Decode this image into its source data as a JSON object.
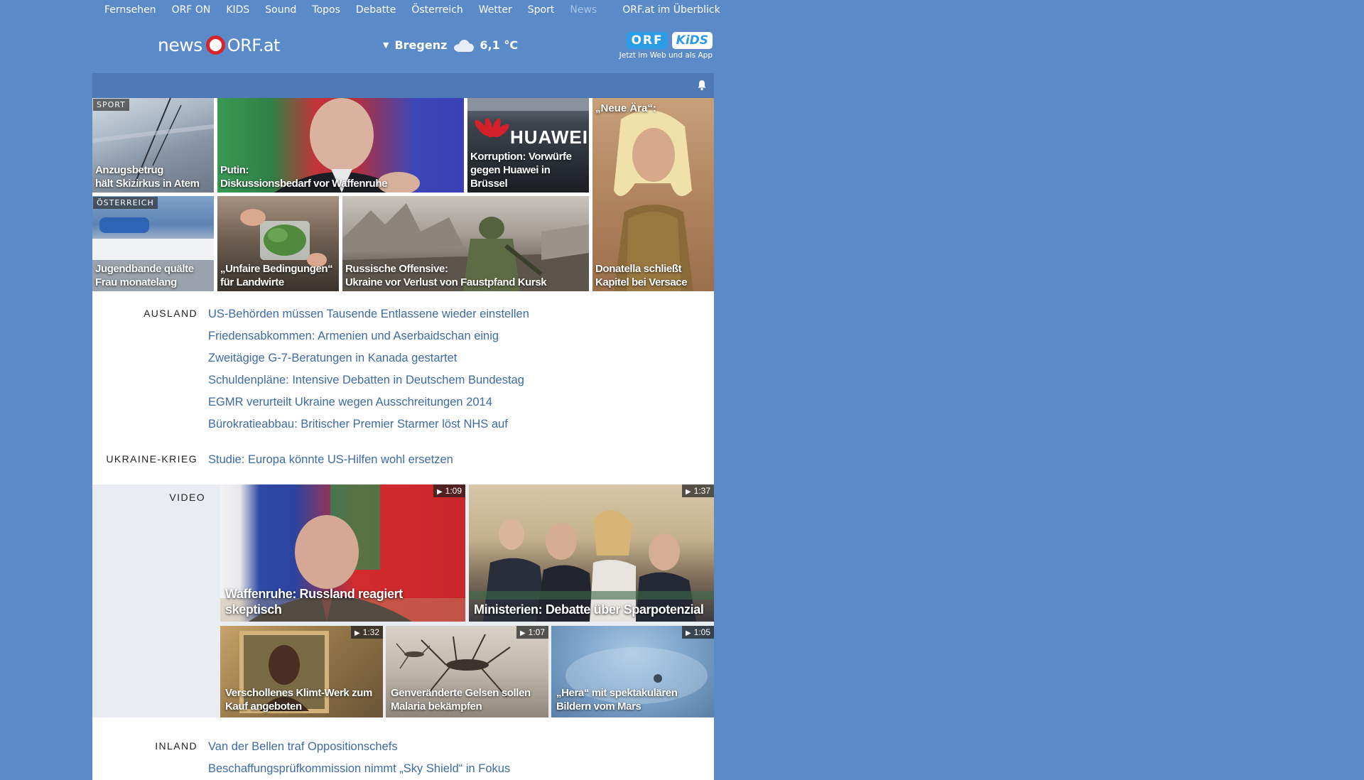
{
  "topnav": {
    "items": [
      "Fernsehen",
      "ORF ON",
      "KIDS",
      "Sound",
      "Topos",
      "Debatte",
      "Österreich",
      "Wetter",
      "Sport",
      "News"
    ],
    "overview": "ORF.at im Überblick"
  },
  "header": {
    "logo_news": "news",
    "logo_orf": "ORF.at",
    "weather_city": "Bregenz",
    "weather_temp": "6,1 °C",
    "weather_icon": "cloud-icon",
    "kids_badge_orf": "ORF",
    "kids_badge_kids": "KiDS",
    "kids_sub": "Jetzt im Web und als App"
  },
  "tiles": [
    {
      "tag": "SPORT",
      "lines": [
        "Anzugsbetrug",
        "hält Skizirkus in Atem"
      ]
    },
    {
      "lines": [
        "Putin:",
        "Diskussionsbedarf vor Waffenruhe"
      ]
    },
    {
      "overlay_text": "HUAWEI",
      "lines": [
        "Korruption: Vorwürfe",
        "gegen Huawei in Brüssel"
      ]
    },
    {
      "top_label": "„Neue Ära“:",
      "lines": [
        "Donatella schließt",
        "Kapitel bei Versace"
      ]
    },
    {
      "tag": "ÖSTERREICH",
      "lines": [
        "Jugendbande quälte",
        "Frau monatelang"
      ]
    },
    {
      "lines": [
        "„Unfaire Bedingungen“",
        "für Landwirte"
      ]
    },
    {
      "lines": [
        "Russische Offensive:",
        "Ukraine vor Verlust von Faustpfand Kursk"
      ]
    }
  ],
  "sections": {
    "ausland": {
      "label": "AUSLAND",
      "links": [
        "US-Behörden müssen Tausende Entlassene wieder einstellen",
        "Friedensabkommen: Armenien und Aserbaidschan einig",
        "Zweitägige G-7-Beratungen in Kanada gestartet",
        "Schuldenpläne: Intensive Debatten in Deutschem Bundestag",
        "EGMR verurteilt Ukraine wegen Ausschreitungen 2014",
        "Bürokratieabbau: Britischer Premier Starmer löst NHS auf"
      ]
    },
    "ukraine": {
      "label": "UKRAINE-KRIEG",
      "links": [
        "Studie: Europa könnte US-Hilfen wohl ersetzen"
      ]
    },
    "video": {
      "label": "VIDEO",
      "items": [
        {
          "duration": "1:09",
          "lines": [
            "Waffenruhe: Russland reagiert skeptisch"
          ]
        },
        {
          "duration": "1:37",
          "lines": [
            "Ministerien: Debatte über Sparpotenzial"
          ]
        },
        {
          "duration": "1:32",
          "lines": [
            "Verschollenes Klimt-Werk zum",
            "Kauf angeboten"
          ]
        },
        {
          "duration": "1:07",
          "lines": [
            "Genveränderte Gelsen sollen",
            "Malaria bekämpfen"
          ]
        },
        {
          "duration": "1:05",
          "lines": [
            "„Hera“ mit spektakulären",
            "Bildern vom Mars"
          ]
        }
      ]
    },
    "inland": {
      "label": "INLAND",
      "links": [
        "Van der Bellen traf Oppositionschefs",
        "Beschaffungsprüfkommission nimmt „Sky Shield“ in Fokus"
      ]
    }
  },
  "colors": {
    "page_bg": "#5a8bc8",
    "bar_bg": "#4d7ab7",
    "link": "#3d6ba4",
    "logo_red": "#d5262d",
    "video_bg": "#e9edf2"
  }
}
